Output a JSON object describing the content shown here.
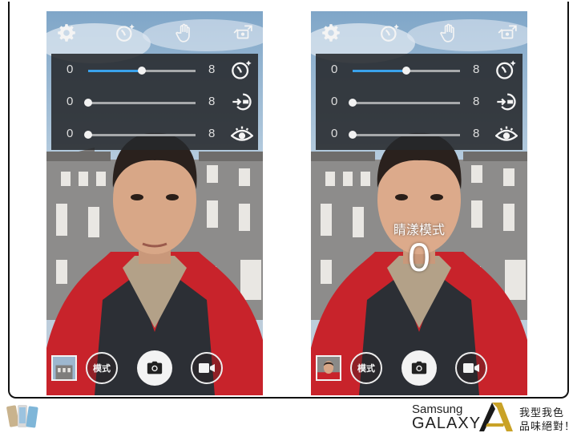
{
  "left_screen": {
    "top_icons": [
      "settings-gear-icon",
      "beauty-face-icon",
      "palm-gesture-icon",
      "switch-camera-icon"
    ],
    "sliders": [
      {
        "min": "0",
        "max": "8",
        "value": 4,
        "icon": "beauty-face-icon"
      },
      {
        "min": "0",
        "max": "8",
        "value": 0,
        "icon": "slim-face-icon"
      },
      {
        "min": "0",
        "max": "8",
        "value": 0,
        "icon": "eye-enlarge-icon"
      }
    ],
    "mode_label": "模式",
    "thumbnail": "building-thumbnail"
  },
  "right_screen": {
    "top_icons": [
      "settings-gear-icon",
      "beauty-face-icon",
      "palm-gesture-icon",
      "switch-camera-icon"
    ],
    "sliders": [
      {
        "min": "0",
        "max": "8",
        "value": 4,
        "icon": "beauty-face-icon"
      },
      {
        "min": "0",
        "max": "8",
        "value": 0,
        "icon": "slim-face-icon"
      },
      {
        "min": "0",
        "max": "8",
        "value": 0,
        "icon": "eye-enlarge-icon"
      }
    ],
    "overlay_label": "睛漾模式",
    "overlay_value": "0",
    "mode_label": "模式",
    "thumbnail": "selfie-thumbnail"
  },
  "footer": {
    "brand_line1": "Samsung",
    "brand_line2": "GALAXY",
    "brand_letter": "A",
    "tagline1": "我型我色",
    "tagline2": "品味絕對！"
  },
  "colors": {
    "slider_fill": "#3aa2ec",
    "panel_bg": "#26282b",
    "sky": "#8fb2cf",
    "jacket_red": "#c8232b"
  }
}
